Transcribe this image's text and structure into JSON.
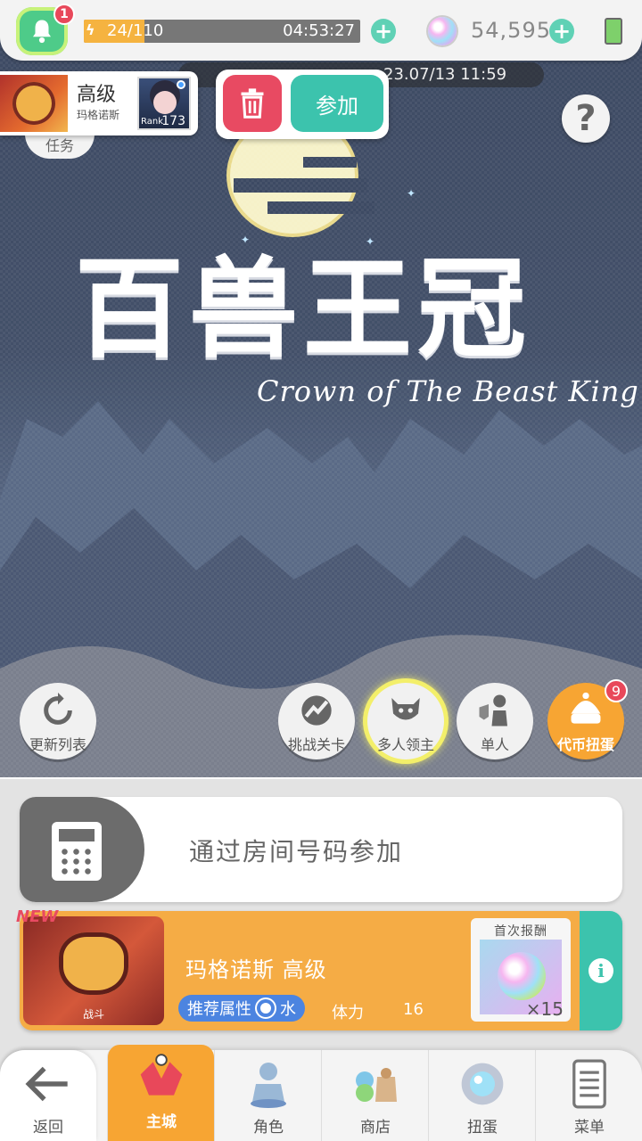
{
  "topbar": {
    "notification_count": "1",
    "stamina_text": "24/110",
    "stamina_fraction": 0.218,
    "stamina_timer": "04:53:27",
    "gem_count": "54,595"
  },
  "ticker": {
    "text": "23.07/13 11:59"
  },
  "room_card": {
    "level": "高级",
    "boss_name": "玛格诺斯",
    "rank_label": "Rank",
    "rank_value": "173",
    "tab_label": "任务"
  },
  "actions": {
    "join_label": "参加"
  },
  "title": {
    "cn": "百兽王冠",
    "en": "Crown of The Beast King"
  },
  "modes": [
    {
      "label": "更新列表",
      "icon": "refresh-icon"
    },
    {
      "label": "挑战关卡",
      "icon": "challenge-icon"
    },
    {
      "label": "多人领主",
      "icon": "multi-boss-icon"
    },
    {
      "label": "单人",
      "icon": "solo-icon"
    },
    {
      "label": "代币扭蛋",
      "icon": "gacha-icon",
      "badge": "9"
    }
  ],
  "room_input": {
    "label": "通过房间号码参加"
  },
  "quest": {
    "new_tag": "NEW",
    "boss_label": "战斗",
    "title": "玛格诺斯 高级",
    "attr_prefix": "推荐属性",
    "attr_value": "水",
    "stamina_label": "体力",
    "stamina_value": "16",
    "reward_title": "首次报酬",
    "reward_qty": "×15"
  },
  "nav": [
    {
      "label": "返回",
      "icon": "back-arrow-icon"
    },
    {
      "label": "主城",
      "icon": "home-icon",
      "active": true
    },
    {
      "label": "角色",
      "icon": "character-icon"
    },
    {
      "label": "商店",
      "icon": "shop-icon"
    },
    {
      "label": "扭蛋",
      "icon": "gacha-machine-icon"
    },
    {
      "label": "菜单",
      "icon": "menu-icon"
    }
  ],
  "colors": {
    "accent_teal": "#3cc3ad",
    "accent_orange": "#f7a533",
    "delete_red": "#e84a62",
    "notification_green": "#4ecb89"
  }
}
